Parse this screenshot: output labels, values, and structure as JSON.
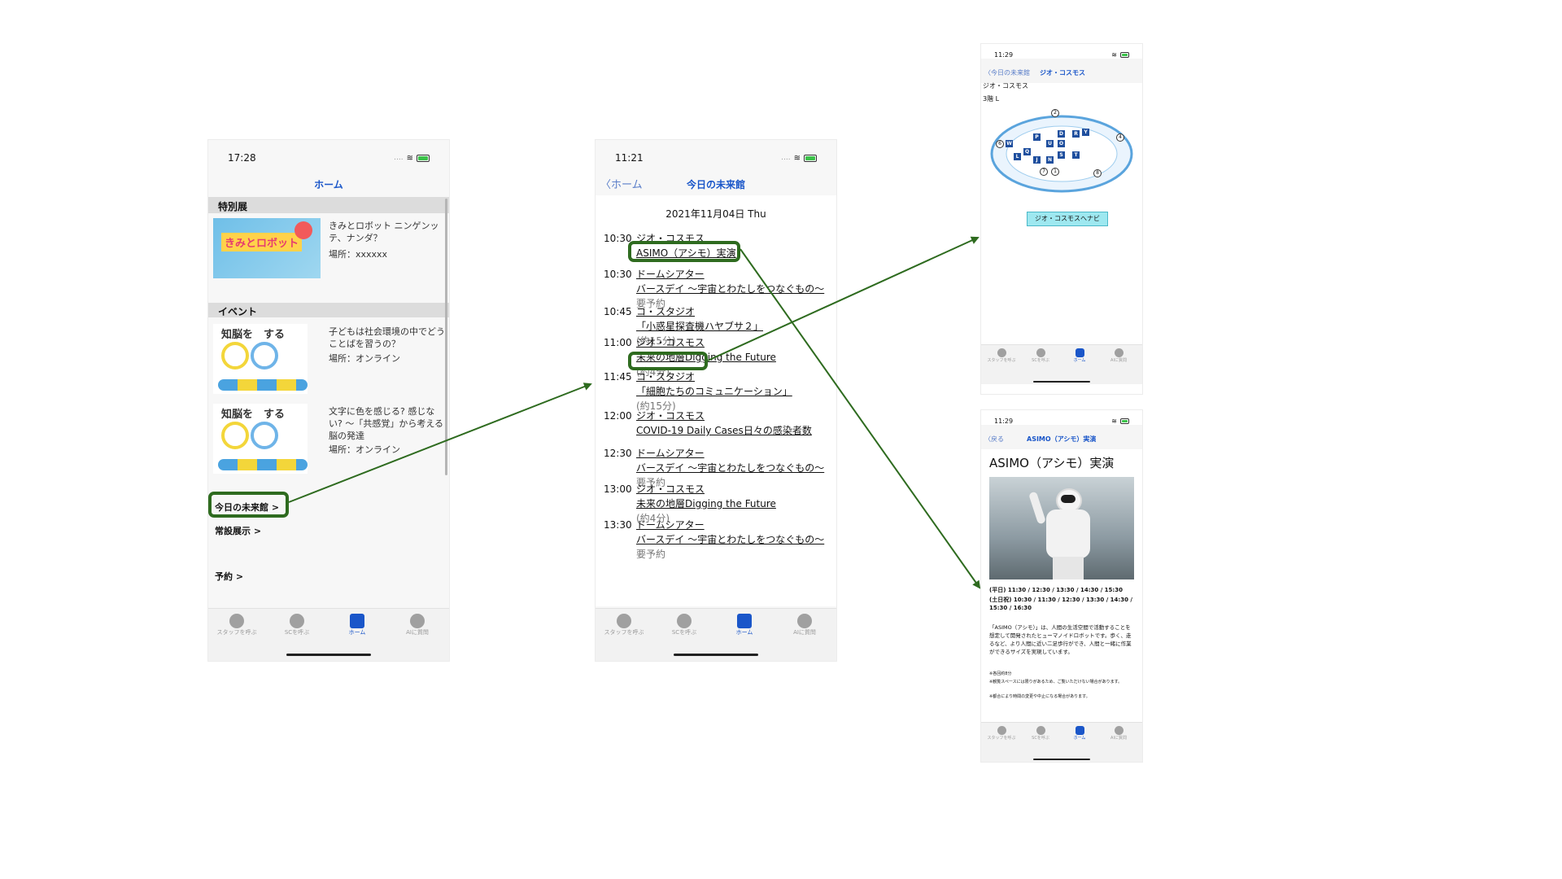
{
  "phone1": {
    "time": "17:28",
    "nav_title": "ホーム",
    "special_header": "特別展",
    "special_item": {
      "title": "きみとロボット ニンゲンッテ、ナンダ？",
      "place": "場所：xxxxxx",
      "image_text": "きみとロボット"
    },
    "event_header": "イベント",
    "events": [
      {
        "title": "子どもは社会環境の中でどうことばを習うの？",
        "place": "場所：オンライン",
        "image_text": "知脳を　する"
      },
      {
        "title": "文字に色を感じる? 感じない? 〜「共感覚」から考える脳の発達",
        "place": "場所：オンライン",
        "image_text": "知脳を　する"
      }
    ],
    "links": [
      "今日の未来館 >",
      "常設展示 >",
      "予約 >"
    ]
  },
  "phone2": {
    "time": "11:21",
    "back": "ホーム",
    "nav_title": "今日の未来館",
    "date": "2021年11月04日 Thu",
    "schedule": [
      {
        "time": "10:30",
        "place": "ジオ・コスモス",
        "title": "ASIMO（アシモ）実演",
        "note": ""
      },
      {
        "time": "10:30",
        "place": "ドームシアター",
        "title": "バースデイ 〜宇宙とわたしをつなぐもの〜",
        "note": "要予約"
      },
      {
        "time": "10:45",
        "place": "コ・スタジオ",
        "title": "「小惑星探査機ハヤブサ２」",
        "note": "(約15分)"
      },
      {
        "time": "11:00",
        "place": "ジオ・コスモス",
        "title": "未来の地層Digging the Future",
        "note": "(約4分)"
      },
      {
        "time": "11:45",
        "place": "コ・スタジオ",
        "title": "「細胞たちのコミュニケーション」",
        "note": "(約15分)"
      },
      {
        "time": "12:00",
        "place": "ジオ・コスモス",
        "title": "COVID-19 Daily Cases日々の感染者数",
        "note": ""
      },
      {
        "time": "12:30",
        "place": "ドームシアター",
        "title": "バースデイ 〜宇宙とわたしをつなぐもの〜",
        "note": "要予約"
      },
      {
        "time": "13:00",
        "place": "ジオ・コスモス",
        "title": "未来の地層Digging the Future",
        "note": "(約4分)"
      },
      {
        "time": "13:30",
        "place": "ドームシアター",
        "title": "バースデイ 〜宇宙とわたしをつなぐもの〜",
        "note": "要予約"
      }
    ]
  },
  "phone3": {
    "time": "11:29",
    "back": "今日の未来館",
    "nav_title": "ジオ・コスモス",
    "location": "ジオ・コスモス",
    "floor": "3階 L",
    "map_letters": [
      "W",
      "L",
      "P",
      "U",
      "D",
      "R",
      "Y",
      "J",
      "N",
      "S",
      "T",
      "O",
      "Q"
    ],
    "map_numbers": [
      "2",
      "4",
      "6",
      "7",
      "1",
      "8"
    ],
    "nav_button": "ジオ・コスモスへナビ"
  },
  "phone4": {
    "time": "11:29",
    "back": "戻る",
    "nav_title": "ASIMO（アシモ）実演",
    "heading": "ASIMO（アシモ）実演",
    "weekday": "(平日) 11:30 / 12:30 / 13:30 / 14:30 / 15:30",
    "weekend": "(土日祝) 10:30 / 11:30 / 12:30 / 13:30 / 14:30 / 15:30 / 16:30",
    "description": "「ASIMO（アシモ）」は、人間の生活空間で活動することを想定して開発されたヒューマノイドロボットです。歩く、走るなど、より人間に近い二足歩行ができ、人間と一緒に作業ができるサイズを実現しています。",
    "notes": [
      "※各回約8分",
      "※観覧スペースには限りがあるため、ご覧いただけない場合があります。",
      "※都合により時間の変更や中止になる場合があります。"
    ]
  },
  "tabs": [
    "スタッフを呼ぶ",
    "SCを呼ぶ",
    "ホーム",
    "AIに質問"
  ],
  "colors": {
    "accent": "#1a56c9",
    "highlight": "#2e6b1f",
    "button": "#9ee8f0"
  }
}
